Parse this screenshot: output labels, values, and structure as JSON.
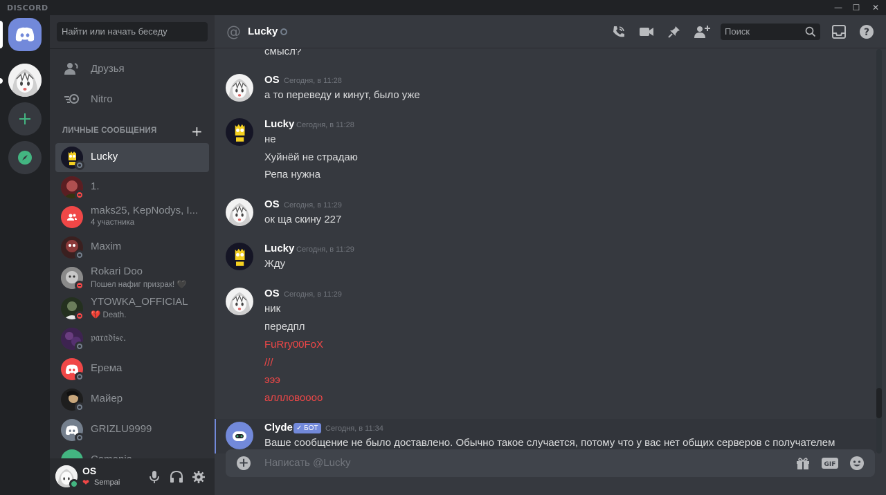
{
  "app": {
    "brand": "DISCORD"
  },
  "sidebar": {
    "search_placeholder": "Найти или начать беседу",
    "nav": [
      {
        "label": "Друзья",
        "icon": "friends-icon"
      },
      {
        "label": "Nitro",
        "icon": "nitro-icon"
      }
    ],
    "dm_header": "ЛИЧНЫЕ СООБЩЕНИЯ",
    "dms": [
      {
        "name": "Lucky",
        "sub": "",
        "status": "offline",
        "active": true
      },
      {
        "name": "1.",
        "sub": "",
        "status": "dnd"
      },
      {
        "name": "maks25, KepNodys, I...",
        "sub": "4 участника",
        "status": "group"
      },
      {
        "name": "Maxim",
        "sub": "",
        "status": "offline"
      },
      {
        "name": "Rokari Doo",
        "sub": "Пошел нафиг призрак! 🖤",
        "status": "dnd"
      },
      {
        "name": "YTOWKA_OFFICIAL",
        "sub": "💔 Death.",
        "status": "dnd"
      },
      {
        "name": "𝔭𝔞𝔯𝔞𝔡𝔦𝔰𝔢.",
        "sub": "",
        "status": "offline"
      },
      {
        "name": "Ерема",
        "sub": "",
        "status": "offline"
      },
      {
        "name": "Майер",
        "sub": "",
        "status": "offline"
      },
      {
        "name": "GRIZLU9999",
        "sub": "",
        "status": "offline"
      },
      {
        "name": "Camonia",
        "sub": "",
        "status": "offline"
      }
    ]
  },
  "user": {
    "name": "OS",
    "status_text": "Sempai",
    "status_emoji": "❤"
  },
  "chat": {
    "channel": "Lucky",
    "search_placeholder": "Поиск",
    "composer_placeholder": "Написать @Lucky",
    "top_fragment": "смысл?",
    "groups": [
      {
        "author": "OS",
        "time": "Сегодня, в 11:28",
        "lines": [
          "а то переведу и кинут, было уже"
        ],
        "avatar": "anime"
      },
      {
        "author": "Lucky",
        "time": "Сегодня, в 11:28",
        "lines": [
          "не",
          "Хуйнёй не страдаю",
          "Репа нужна"
        ],
        "avatar": "bart"
      },
      {
        "author": "OS",
        "time": "Сегодня, в 11:29",
        "lines": [
          "ок ща скину 227"
        ],
        "avatar": "anime"
      },
      {
        "author": "Lucky",
        "time": "Сегодня, в 11:29",
        "lines": [
          "Жду"
        ],
        "avatar": "bart"
      },
      {
        "author": "OS",
        "time": "Сегодня, в 11:29",
        "lines": [
          "ник",
          "передпл",
          "FuRry00FoX",
          "///",
          "эээ",
          "аллловоооо"
        ],
        "red_from": 2,
        "avatar": "anime"
      }
    ],
    "clyde": {
      "author": "Clyde",
      "badge": "✓ БОТ",
      "time": "Сегодня, в 11:34",
      "text": "Ваше сообщение не было доставлено. Обычно такое случается, потому что у вас нет общих серверов с получателем"
    }
  },
  "colors": {
    "accent": "#7289da",
    "danger": "#f04747",
    "online": "#43b581"
  }
}
